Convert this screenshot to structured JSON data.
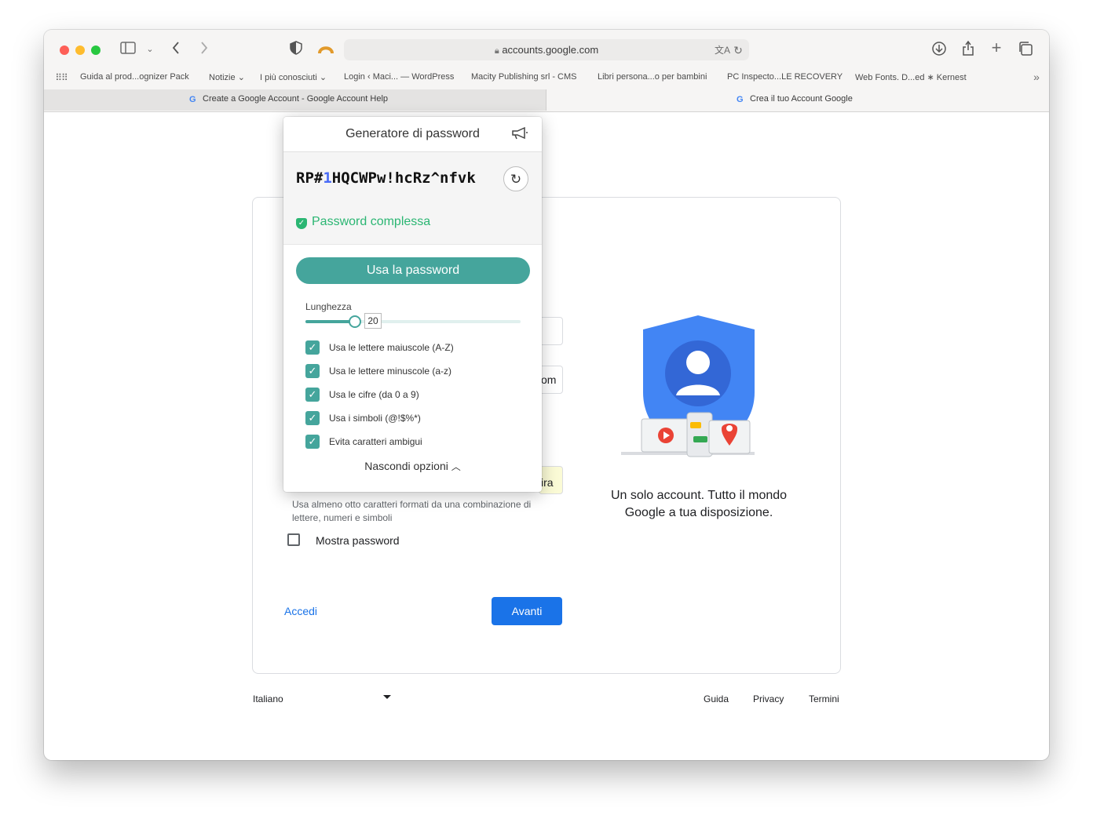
{
  "browser": {
    "address": "accounts.google.com",
    "bookmarks": [
      "Guida al prod...ognizer Pack",
      "Notizie",
      "I più conosciuti",
      "Login ‹ Maci... — WordPress",
      "Macity Publishing srl - CMS",
      "Libri persona...o per bambini",
      "PC Inspecto...LE RECOVERY",
      "Web Fonts. D...ed ∗ Kernest"
    ],
    "tabs": [
      "Create a Google Account - Google Account Help",
      "Crea il tuo Account Google"
    ],
    "icons": {
      "sidebar": "sidebar-icon",
      "back": "chevron-left-icon",
      "forward": "chevron-right-icon",
      "privacy": "shield-icon",
      "extension": "arch-icon",
      "lock": "lock-icon",
      "translate": "translate-icon",
      "reload": "reload-icon",
      "download": "download-icon",
      "share": "share-icon",
      "new_tab": "plus-icon",
      "tab_overview": "tabs-overview-icon",
      "more_bookmarks": "double-chevron-icon"
    }
  },
  "page": {
    "field_fragment_1": "om",
    "field_fragment_2": "ira",
    "help_text": "Usa almeno otto caratteri formati da una combinazione di lettere, numeri e simboli",
    "show_password": "Mostra password",
    "signin_link": "Accedi",
    "next_button": "Avanti",
    "caption": "Un solo account. Tutto il mondo Google a tua disposizione.",
    "footer": {
      "language": "Italiano",
      "links": [
        "Guida",
        "Privacy",
        "Termini"
      ]
    }
  },
  "password_generator": {
    "title": "Generatore di password",
    "password_prefix": "RP#",
    "password_digit": "1",
    "password_suffix": "HQCWPw!hcRz^nfvk",
    "strength": "Password complessa",
    "use_button": "Usa la password",
    "length_label": "Lunghezza",
    "length_value": "20",
    "length_fraction": 0.23,
    "options": [
      {
        "label": "Usa le lettere maiuscole (A-Z)",
        "checked": true
      },
      {
        "label": "Usa le lettere minuscole (a-z)",
        "checked": true
      },
      {
        "label": "Usa le cifre (da 0 a 9)",
        "checked": true
      },
      {
        "label": "Usa i simboli (@!$%*)",
        "checked": true
      },
      {
        "label": "Evita caratteri ambigui",
        "checked": true
      }
    ],
    "hide_options": "Nascondi opzioni",
    "accent_color": "#45a59c",
    "strength_color": "#2bb673"
  },
  "colors": {
    "google_blue": "#1a73e8",
    "shield_blue": "#4285f4"
  }
}
